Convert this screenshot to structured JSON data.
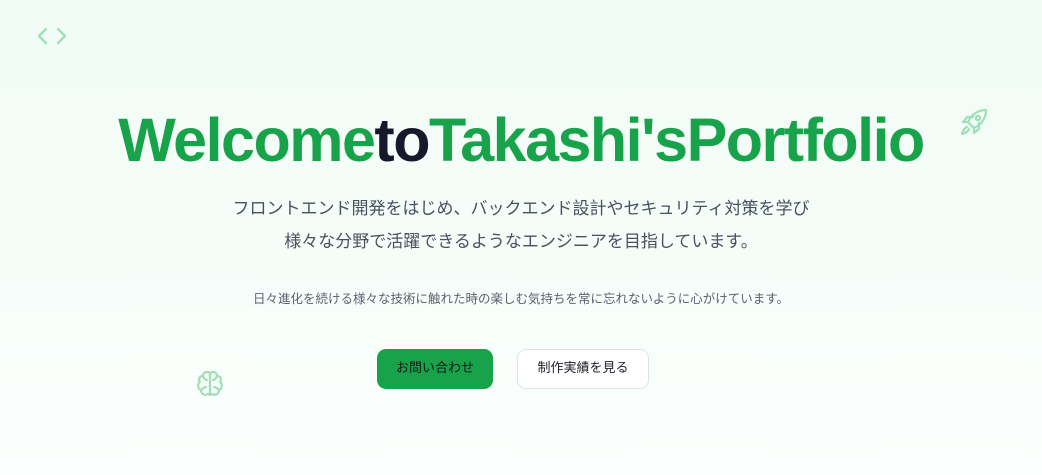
{
  "hero": {
    "title": {
      "part1": "Welcome",
      "part2": "to",
      "part3": "Takashi's",
      "part4": "Portfolio"
    },
    "lead_line1": "フロントエンド開発をはじめ、バックエンド設計やセキュリティ対策を学び",
    "lead_line2": "様々な分野で活躍できるようなエンジニアを目指しています。",
    "subtext": "日々進化を続ける様々な技術に触れた時の楽しむ気持ちを常に忘れないように心がけています。",
    "buttons": {
      "contact_label": "お問い合わせ",
      "works_label": "制作実績を見る"
    }
  },
  "decorations": {
    "icons": [
      "code-icon",
      "rocket-icon",
      "brain-icon"
    ],
    "color": "#9fe0b8"
  },
  "colors": {
    "accent": "#18a34b",
    "title_dark": "#18182d",
    "background": "#f3fcf7"
  }
}
